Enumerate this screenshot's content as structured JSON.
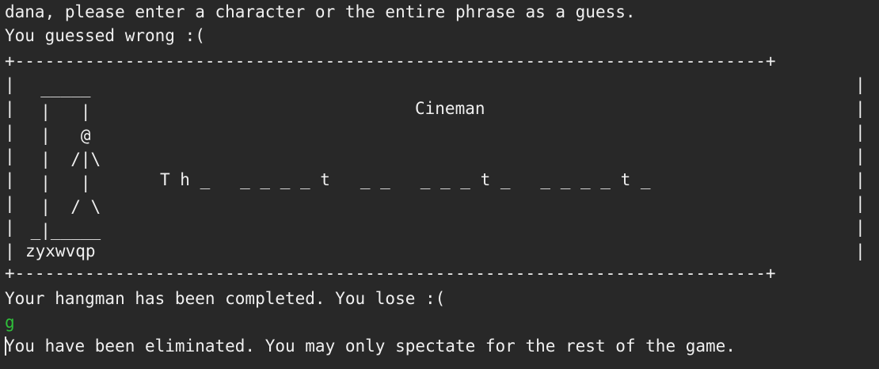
{
  "terminal": {
    "prompt_line": "dana, please enter a character or the entire phrase as a guess.",
    "result_line": "You guessed wrong :(",
    "outcome_line": "Your hangman has been completed. You lose :(",
    "input_echo": "g",
    "status_line": "You have been eliminated. You may only spectate for the rest of the game."
  },
  "board": {
    "border_top": "+---------------------------------------------------------------------------+",
    "border_bottom": "+---------------------------------------------------------------------------+",
    "side_left": "|\n|\n|\n|\n|\n|\n|\n|",
    "side_right": "|\n|\n|\n|\n|\n|\n|\n|",
    "gallows": "  _____\n  |   |\n  |   @\n  |  /|\\\n  |   |\n  |  / \\\n _|_____",
    "guessed_letters": "zyxwvqp",
    "category": "Cineman",
    "phrase": "T h _   _ _ _ _ t   _ _   _ _ _ t _   _ _ _ _ t _"
  },
  "colors": {
    "background": "#282828",
    "text": "#f0f0f0",
    "input_echo": "#2fbf3a"
  }
}
